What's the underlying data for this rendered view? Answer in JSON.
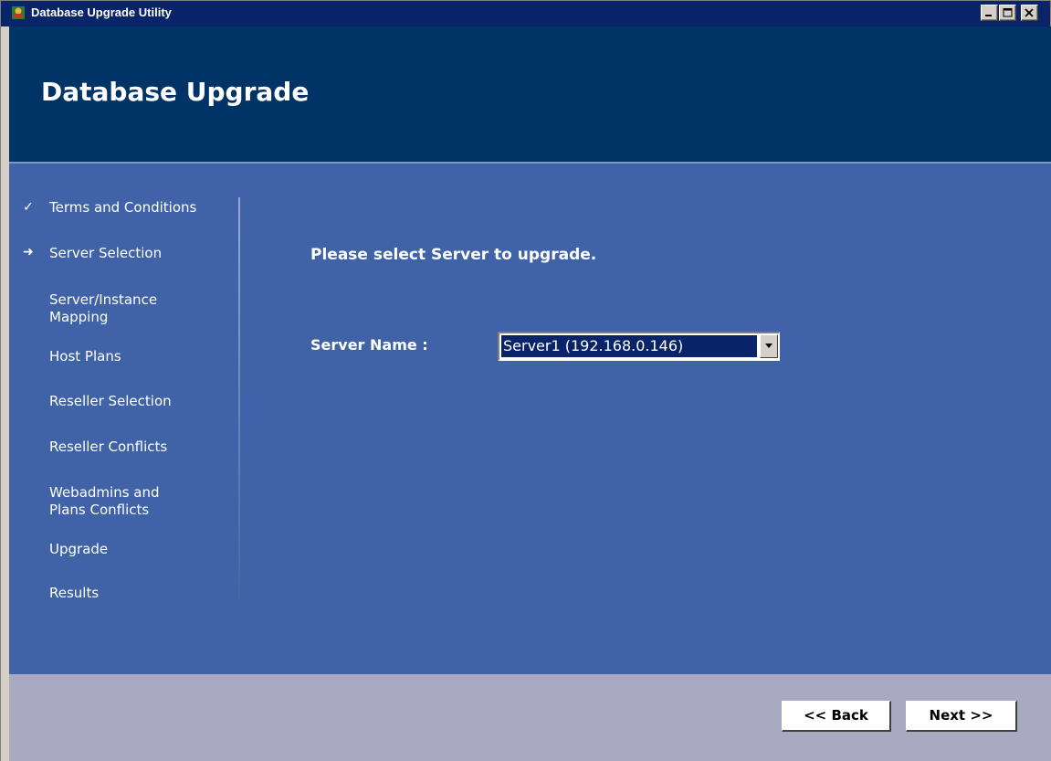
{
  "window": {
    "title": "Database Upgrade Utility",
    "icon": "app-icon"
  },
  "header": {
    "title": "Database Upgrade"
  },
  "steps": [
    {
      "label": "Terms and Conditions",
      "status": "completed",
      "marker": "✓"
    },
    {
      "label": "Server Selection",
      "status": "current",
      "marker": "➜"
    },
    {
      "label": "Server/Instance Mapping",
      "status": "pending",
      "marker": ""
    },
    {
      "label": "Host Plans",
      "status": "pending",
      "marker": ""
    },
    {
      "label": "Reseller Selection",
      "status": "pending",
      "marker": ""
    },
    {
      "label": "Reseller Conflicts",
      "status": "pending",
      "marker": ""
    },
    {
      "label": "Webadmins and Plans Conflicts",
      "status": "pending",
      "marker": ""
    },
    {
      "label": "Upgrade",
      "status": "pending",
      "marker": ""
    },
    {
      "label": "Results",
      "status": "pending",
      "marker": ""
    }
  ],
  "step_lines": {
    "mapping_1": "Server/Instance",
    "mapping_2": "Mapping",
    "webadmins_1": "Webadmins and",
    "webadmins_2": "Plans Conflicts"
  },
  "content": {
    "prompt": "Please select Server to upgrade.",
    "server_label": "Server Name :",
    "server_value": "Server1 (192.168.0.146)"
  },
  "buttons": {
    "back": "<< Back",
    "next": "Next >>"
  },
  "colors": {
    "header": "#003366",
    "main": "#3f63a6",
    "footer": "#a9a9c1",
    "selection": "#0a246a"
  }
}
